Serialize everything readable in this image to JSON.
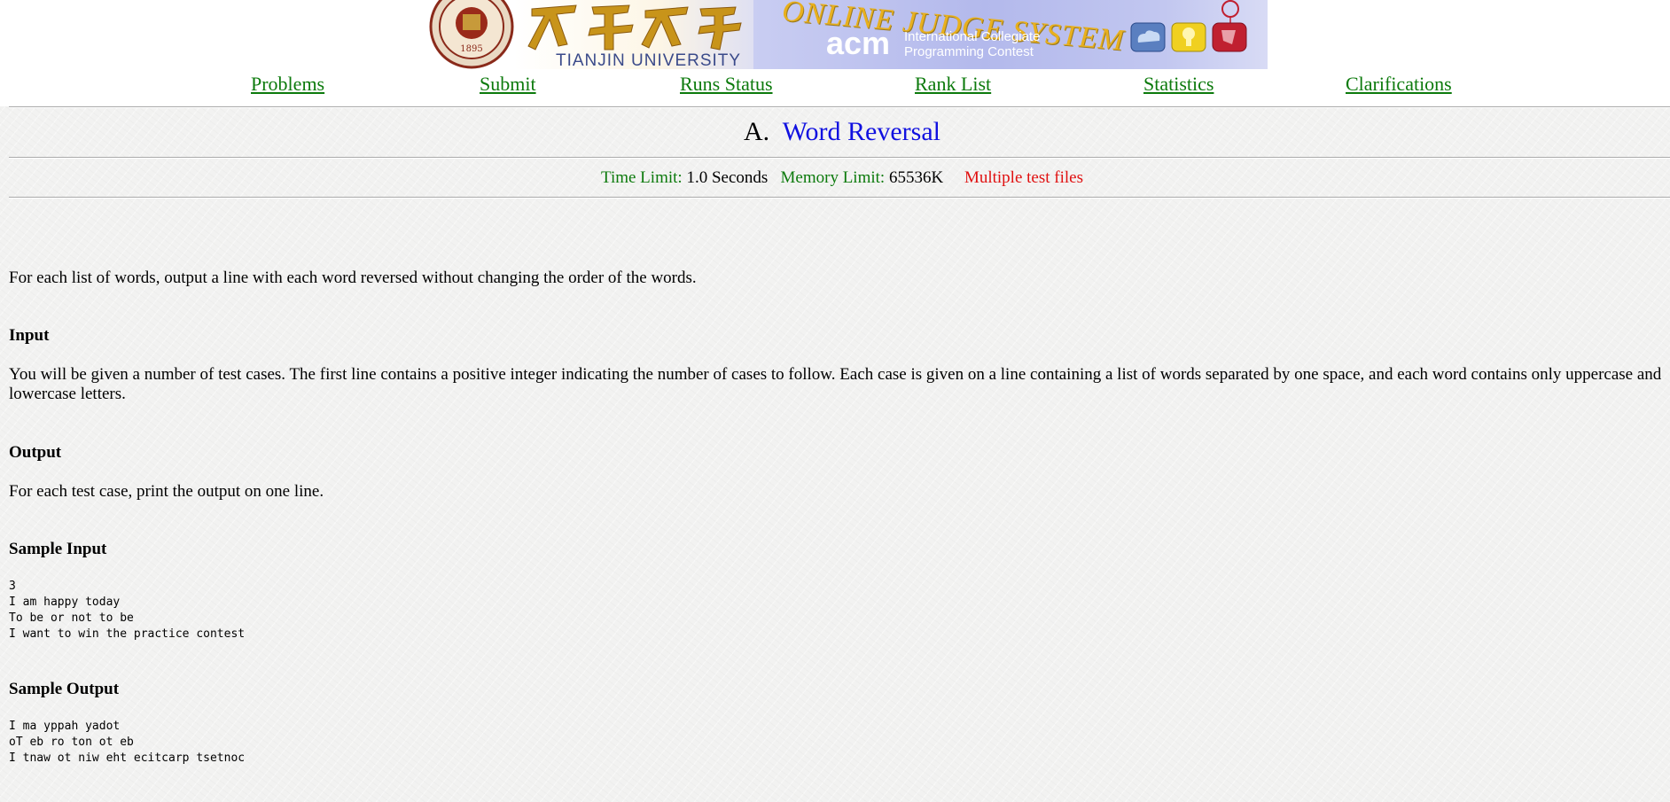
{
  "banner": {
    "university": "TIANJIN  UNIVERSITY",
    "system_title": "ONLINE JUDGE SYSTEM",
    "acm": "acm",
    "acm_line1": "International Collegiate",
    "acm_line2": "Programming Contest"
  },
  "nav": {
    "problems": "Problems",
    "submit": "Submit",
    "runs_status": "Runs Status",
    "rank_list": "Rank List",
    "statistics": "Statistics",
    "clarifications": "Clarifications"
  },
  "problem": {
    "letter": "A.",
    "name": "Word Reversal",
    "time_limit_label": "Time Limit:",
    "time_limit_value": "1.0 Seconds",
    "memory_limit_label": "Memory Limit:",
    "memory_limit_value": "65536K",
    "multiple_files": "Multiple test files",
    "description": "For each list of words, output a line with each word reversed without changing the order of the words.",
    "input_heading": "Input",
    "input_text": "You will be given a number of test cases. The first line contains a positive integer indicating the number of cases to follow. Each case is given on a line containing a list of words separated by one space, and each word contains only uppercase and lowercase letters.",
    "output_heading": "Output",
    "output_text": "For each test case, print the output on one line.",
    "sample_input_heading": "Sample Input",
    "sample_input": "3\nI am happy today\nTo be or not to be\nI want to win the practice contest",
    "sample_output_heading": "Sample Output",
    "sample_output": "I ma yppah yadot\noT eb ro ton ot eb\nI tnaw ot niw eht ecitcarp tsetnoc"
  }
}
